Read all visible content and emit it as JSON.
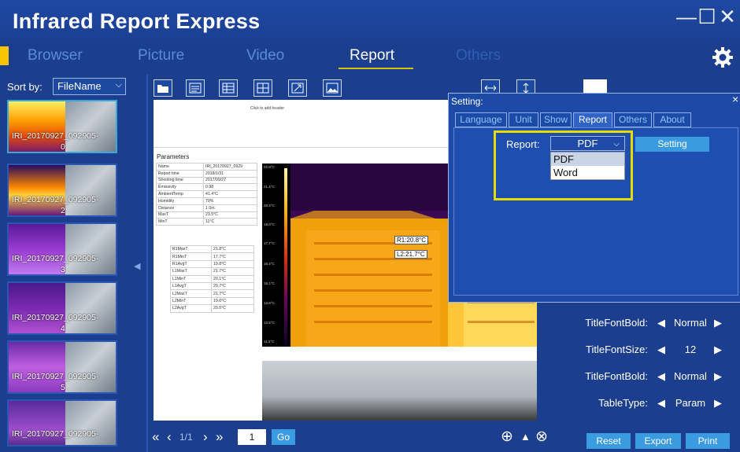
{
  "app": {
    "title": "Infrared Report Express",
    "window_controls": [
      "—",
      "☐",
      "✕"
    ]
  },
  "nav": {
    "tabs": [
      {
        "label": "Browser",
        "active": false
      },
      {
        "label": "Picture",
        "active": false
      },
      {
        "label": "Video",
        "active": false
      },
      {
        "label": "Report",
        "active": true
      },
      {
        "label": "Others",
        "active": false
      }
    ],
    "settings_icon": "gear-icon"
  },
  "sidebar": {
    "sort_label": "Sort by:",
    "sort_value": "FileName",
    "thumbnails": [
      {
        "caption": "IRI_20170927_092905-",
        "number": "0",
        "selected": true
      },
      {
        "caption": "IRI_20170927_092905-",
        "number": "2",
        "selected": false
      },
      {
        "caption": "IRI_20170927_092905-",
        "number": "3",
        "selected": false
      },
      {
        "caption": "IRI_20170927_092905-",
        "number": "4",
        "selected": false
      },
      {
        "caption": "IRI_20170927_092905-",
        "number": "5",
        "selected": false
      },
      {
        "caption": "IRI_20170927_092905-",
        "number": "",
        "selected": false
      }
    ]
  },
  "toolbar": {
    "icons": [
      "folder-icon",
      "text-box-icon",
      "table-icon",
      "grid-icon",
      "arrow-icon",
      "image-icon"
    ]
  },
  "document": {
    "header_hint": "Click to add header",
    "params_title": "Parameters",
    "params": [
      [
        "Name",
        "IRI_20170927_0929"
      ],
      [
        "Report time",
        "2018/1/31"
      ],
      [
        "Shooting time",
        "2017/09/27"
      ],
      [
        "Emissivity",
        "0.98"
      ],
      [
        "AmbientTemp",
        "41.4°C"
      ],
      [
        "Humidity",
        "70%"
      ],
      [
        "Distance",
        "1.0m"
      ],
      [
        "MaxT",
        "23.5°C"
      ],
      [
        "MinT",
        "11°C"
      ]
    ],
    "measurements": [
      [
        "R1MaxT",
        "21.8°C"
      ],
      [
        "R1MinT",
        "17.7°C"
      ],
      [
        "R1AvgT",
        "19.8°C"
      ],
      [
        "L1MaxT",
        "21.7°C"
      ],
      [
        "L1MinT",
        "20.1°C"
      ],
      [
        "L1AvgT",
        "20.7°C"
      ],
      [
        "L2MaxT",
        "21.7°C"
      ],
      [
        "L2MinT",
        "19.0°C"
      ],
      [
        "L2AvgT",
        "20.5°C"
      ]
    ],
    "scale_ticks": [
      "22.9°C",
      "21.4°C",
      "20.3°C",
      "19.0°C",
      "17.7°C",
      "16.4°C",
      "15.1°C",
      "13.8°C",
      "12.5°C",
      "11.2°C"
    ],
    "marker_r1": "R1:20.8°C",
    "marker_l2": "L2:21.7°C"
  },
  "dialog": {
    "title": "Setting:",
    "tabs": [
      {
        "label": "Language",
        "active": false
      },
      {
        "label": "Unit",
        "active": false
      },
      {
        "label": "Show",
        "active": false
      },
      {
        "label": "Report",
        "active": true
      },
      {
        "label": "Others",
        "active": false
      },
      {
        "label": "About",
        "active": false
      }
    ],
    "report_label": "Report:",
    "report_value": "PDF",
    "options": [
      "PDF",
      "Word"
    ],
    "setting_button": "Setting",
    "accent": "#e6dc00"
  },
  "right_panel": {
    "rows": [
      {
        "label": "TitleFontBold:",
        "value": "Normal"
      },
      {
        "label": "TitleFontSize:",
        "value": "12"
      },
      {
        "label": "TitleFontBold:",
        "value": "Normal"
      },
      {
        "label": "TableType:",
        "value": "Param"
      }
    ]
  },
  "bottom": {
    "page_info": "1/1",
    "page_input": "1",
    "go_label": "Go",
    "actions": [
      "Reset",
      "Export",
      "Print"
    ]
  }
}
